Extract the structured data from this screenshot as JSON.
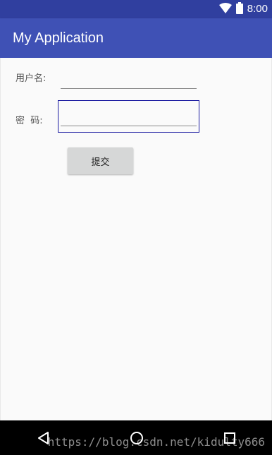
{
  "status_bar": {
    "time": "8:00",
    "icons": [
      "wifi-icon",
      "battery-icon"
    ]
  },
  "app_bar": {
    "title": "My Application",
    "color": "#3f51b5",
    "status_color": "#303f9f"
  },
  "form": {
    "username_label": "用户名:",
    "username_value": "",
    "password_label": "密  码:",
    "password_value": "",
    "submit_label": "提交"
  },
  "nav_bar": {
    "icons": [
      "back-icon",
      "home-icon",
      "recents-icon"
    ]
  },
  "watermark": "https://blog.csdn.net/kidulty666"
}
